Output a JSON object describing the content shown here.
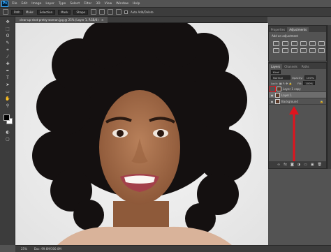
{
  "app": {
    "logo": "Ps"
  },
  "menu": [
    "File",
    "Edit",
    "Image",
    "Layer",
    "Type",
    "Select",
    "Filter",
    "3D",
    "View",
    "Window",
    "Help"
  ],
  "options_bar": {
    "mode_value": "Path",
    "make_label": "Make:",
    "selection_label": "Selection",
    "mask_label": "Mask",
    "shape_label": "Shape",
    "auto_label": "Auto Add/Delete"
  },
  "document": {
    "tab_label": "clear-up-shot-pretty-woman.jpg @ 25% (Layer 1, RGB/8)",
    "close_glyph": "×"
  },
  "status": {
    "zoom": "25%",
    "doc_info": "Doc: 99.6M/300.0M"
  },
  "adjustments_panel": {
    "tabs": [
      "Properties",
      "Adjustments"
    ],
    "active_tab": "Adjustments",
    "title": "Add an adjustment"
  },
  "layers_panel": {
    "tabs": [
      "Layers",
      "Channels",
      "Paths"
    ],
    "active_tab": "Layers",
    "filter_value": "Kind",
    "blend_mode": "Normal",
    "opacity_label": "Opacity:",
    "opacity_value": "100%",
    "lock_label": "Lock:",
    "fill_label": "Fill:",
    "fill_value": "100%",
    "layers": [
      {
        "name": "Layer 1 copy",
        "visible": false,
        "selected": false
      },
      {
        "name": "Layer 1",
        "visible": true,
        "selected": true
      },
      {
        "name": "Background",
        "visible": true,
        "selected": false
      }
    ]
  },
  "colors": {
    "annotation": "#e0141e",
    "panel_bg": "#535353",
    "dark_bg": "#3c3c3c"
  },
  "icons": {
    "tools": [
      "move-icon",
      "marquee-icon",
      "lasso-icon",
      "quick-select-icon",
      "crop-icon",
      "eyedropper-icon",
      "healing-icon",
      "brush-icon",
      "stamp-icon",
      "history-brush-icon",
      "eraser-icon",
      "gradient-icon",
      "blur-icon",
      "dodge-icon",
      "pen-icon",
      "type-icon",
      "path-select-icon",
      "shape-icon",
      "hand-icon",
      "zoom-icon",
      "more-tools-icon"
    ]
  }
}
